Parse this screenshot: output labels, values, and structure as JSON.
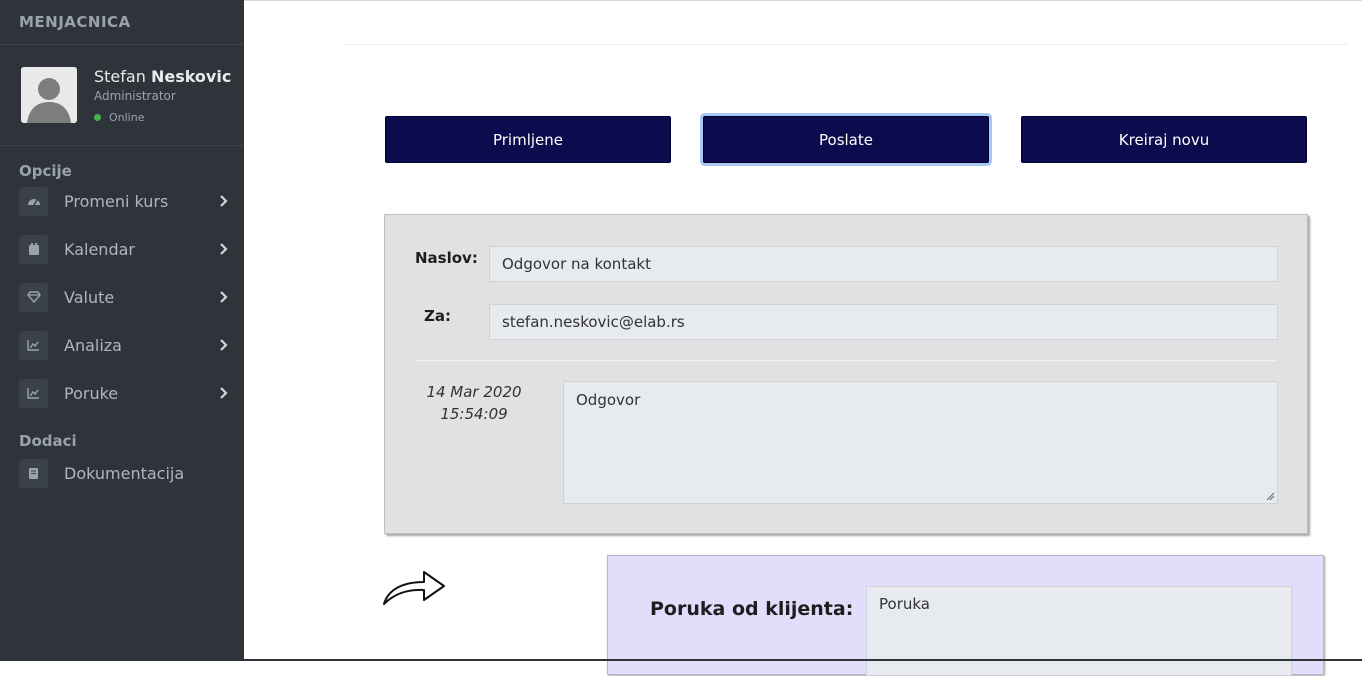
{
  "sidebar": {
    "brand": "MENJACNICA",
    "user": {
      "first_name": "Stefan",
      "last_name": "Neskovic",
      "role": "Administrator",
      "status": "Online",
      "status_color": "#4caf50"
    },
    "sections": [
      {
        "title": "Opcije",
        "items": [
          {
            "label": "Promeni kurs",
            "icon": "dashboard-icon"
          },
          {
            "label": "Kalendar",
            "icon": "calendar-icon"
          },
          {
            "label": "Valute",
            "icon": "diamond-icon"
          },
          {
            "label": "Analiza",
            "icon": "area-chart-icon"
          },
          {
            "label": "Poruke",
            "icon": "area-chart-icon"
          }
        ]
      },
      {
        "title": "Dodaci",
        "items": [
          {
            "label": "Dokumentacija",
            "icon": "book-icon"
          }
        ]
      }
    ]
  },
  "tabs": {
    "received": "Primljene",
    "sent": "Poslate",
    "create": "Kreiraj novu",
    "active": "sent",
    "color": "#0b0b4d"
  },
  "message": {
    "title_label": "Naslov:",
    "title_value": "Odgovor na kontakt",
    "to_label": "Za:",
    "to_value": "stefan.neskovic@elab.rs",
    "date": "14 Mar 2020",
    "time": "15:54:09",
    "body": "Odgovor"
  },
  "client_message": {
    "title": "Poruka od klijenta:",
    "body": "Poruka",
    "background": "#e3dcfa"
  }
}
